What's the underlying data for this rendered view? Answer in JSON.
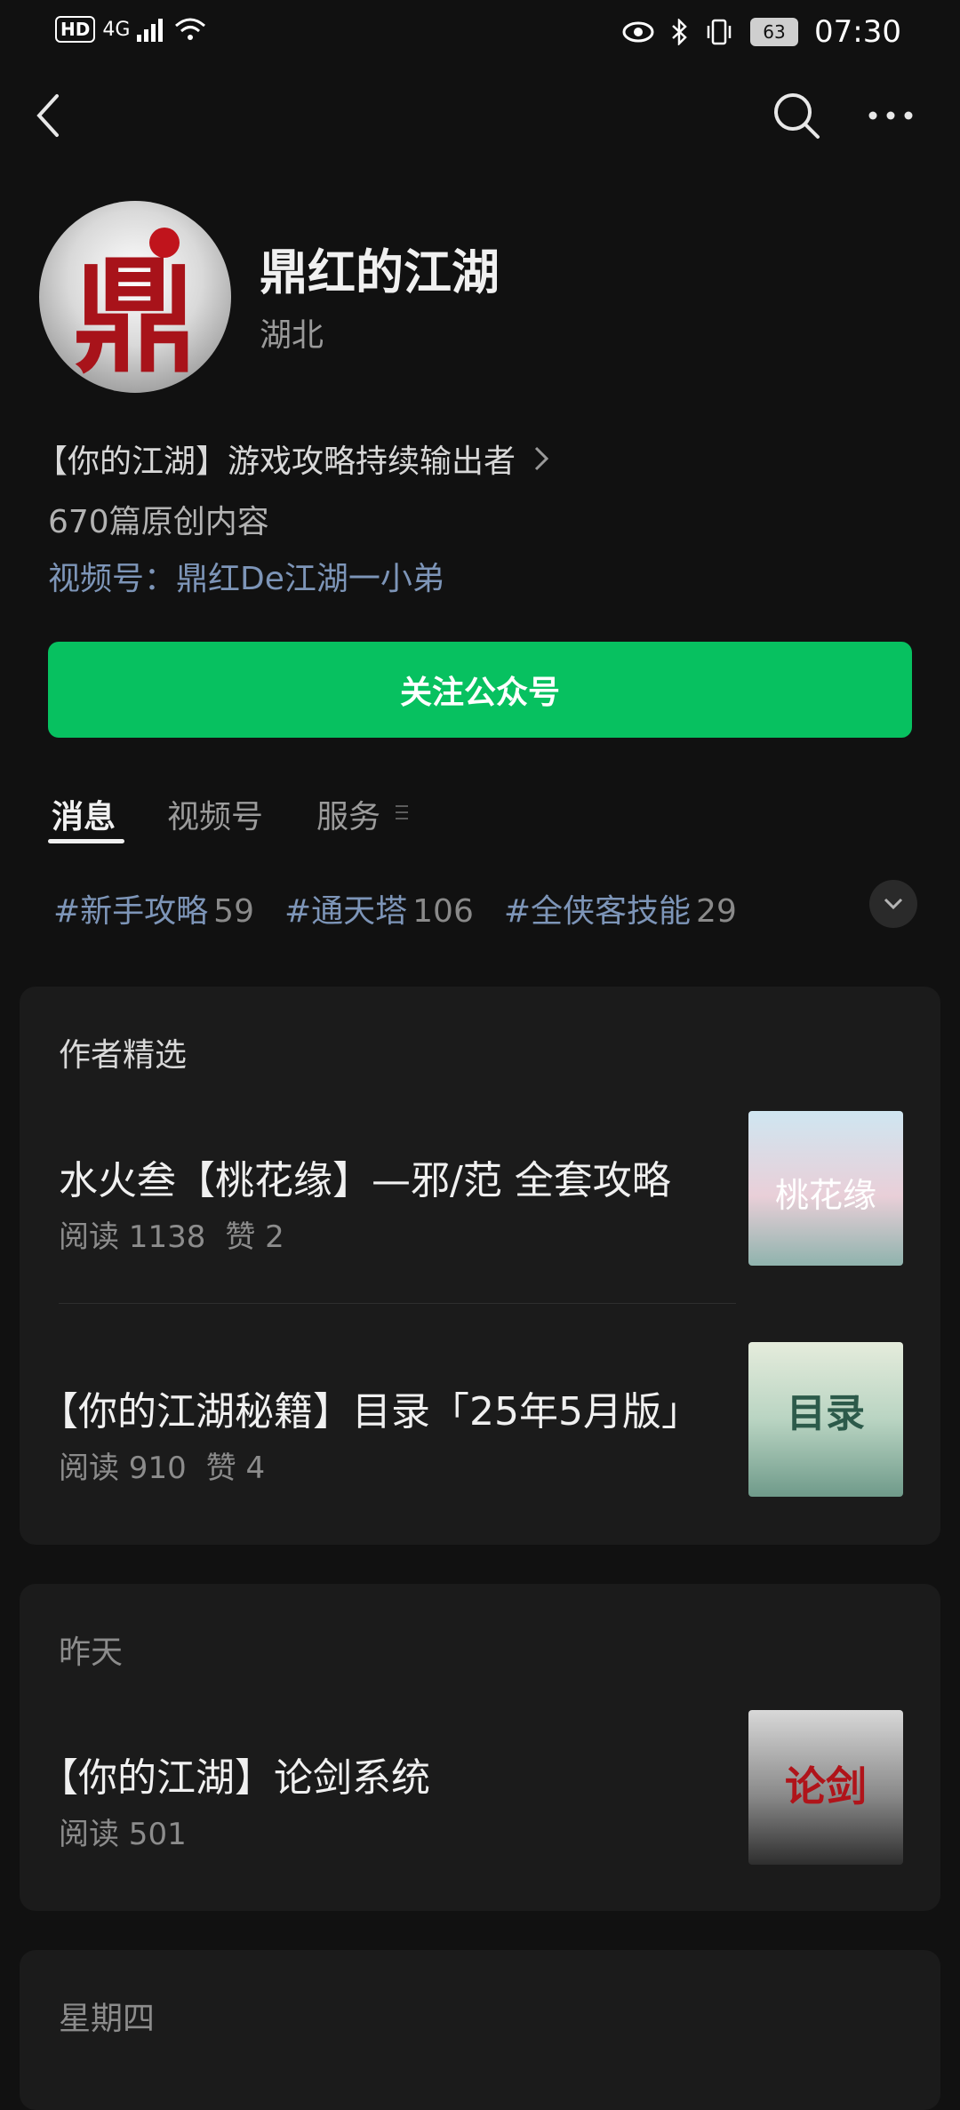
{
  "status_bar": {
    "left_text": "HD",
    "network": "4G",
    "battery": "63",
    "time": "07:30"
  },
  "profile": {
    "avatar_glyph": "鼎",
    "name": "鼎红的江湖",
    "region": "湖北",
    "intro": "【你的江湖】游戏攻略持续输出者",
    "original_count": "670篇原创内容",
    "channel": "视频号：鼎红De江湖一小弟",
    "follow_button": "关注公众号"
  },
  "tabs": [
    {
      "label": "消息"
    },
    {
      "label": "视频号"
    },
    {
      "label": "服务"
    }
  ],
  "hashtags": [
    {
      "name": "#新手攻略",
      "count": "59"
    },
    {
      "name": "#通天塔",
      "count": "106"
    },
    {
      "name": "#全侠客技能",
      "count": "29"
    }
  ],
  "featured": {
    "title": "作者精选",
    "articles": [
      {
        "title": "水火叁【桃花缘】—邪/范 全套攻略",
        "reads": "阅读 1138",
        "likes": "赞 2",
        "thumb_text": "桃花缘"
      },
      {
        "title": "【你的江湖秘籍】目录「25年5月版」",
        "reads": "阅读 910",
        "likes": "赞 4",
        "thumb_text": "目录"
      }
    ]
  },
  "yesterday": {
    "title": "昨天",
    "articles": [
      {
        "title": "【你的江湖】论剑系统",
        "reads": "阅读 501",
        "thumb_text": "论剑"
      }
    ]
  },
  "thursday": {
    "title": "星期四"
  },
  "colors": {
    "background": "#111111",
    "card": "#1b1b1b",
    "accent_green": "#07c160",
    "link_blue": "#7d95b8"
  }
}
